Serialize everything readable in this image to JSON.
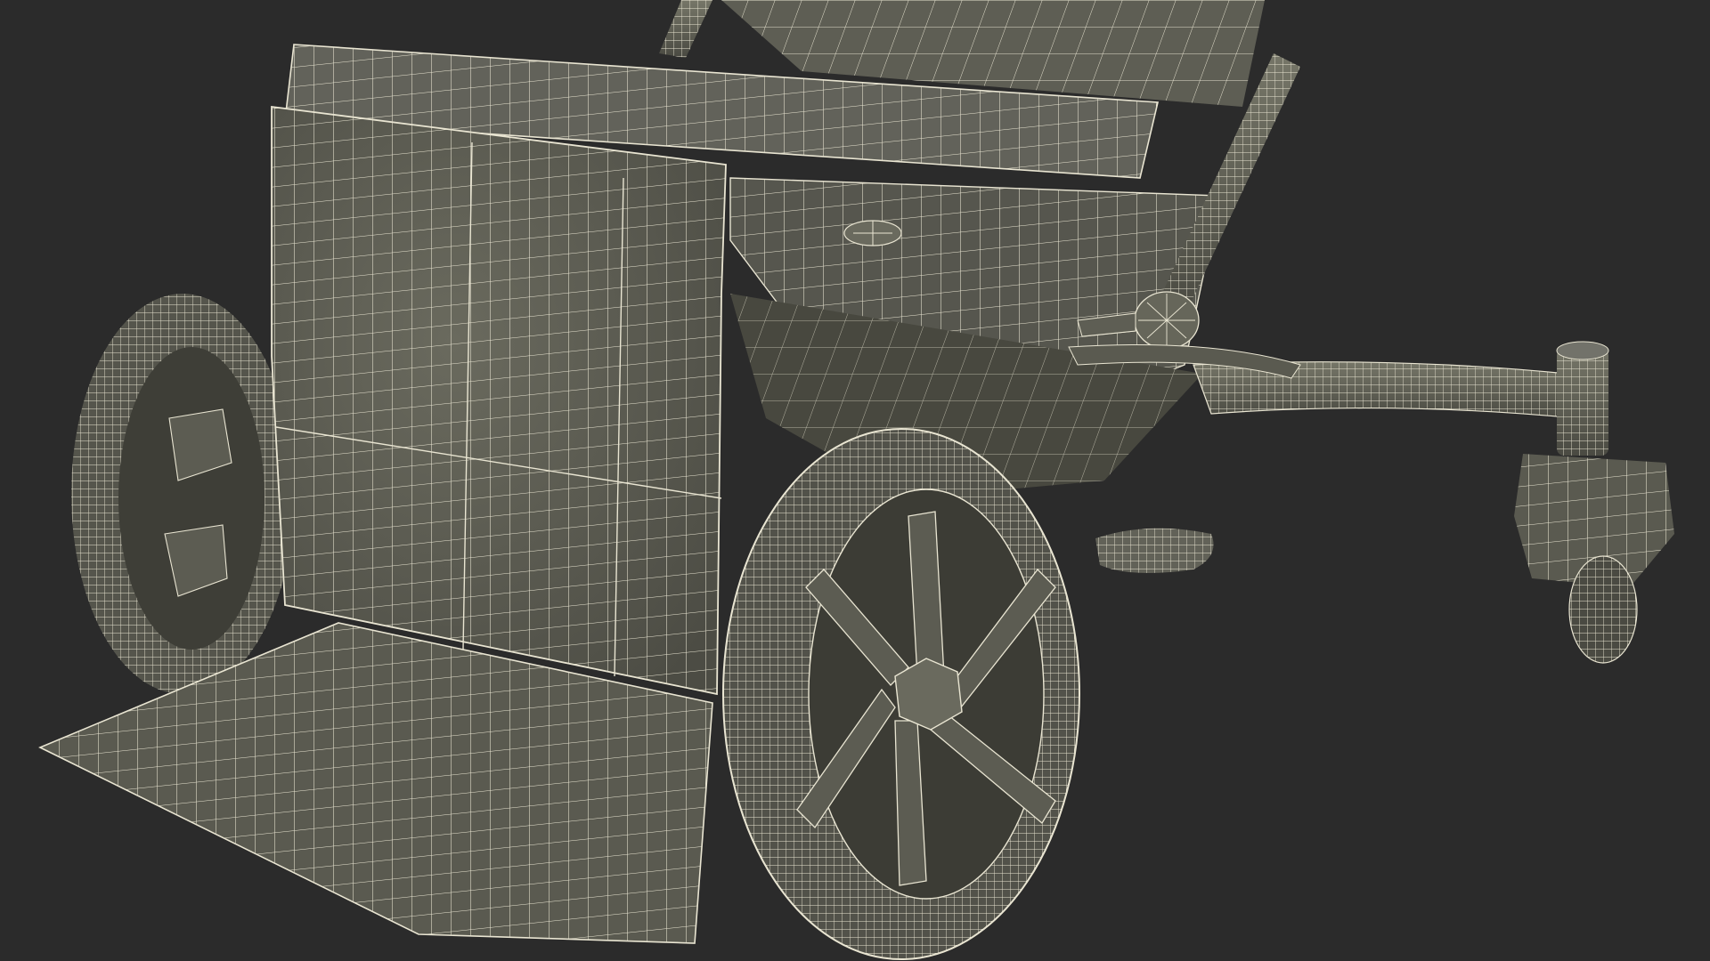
{
  "scene": {
    "subject": "wireframe-mobility-chair",
    "background_color": "#2b2b2b",
    "surface_color": "#5a5a50",
    "surface_light": "#6e6e62",
    "surface_dark": "#404038",
    "wire_color": "#e9e5d2"
  }
}
